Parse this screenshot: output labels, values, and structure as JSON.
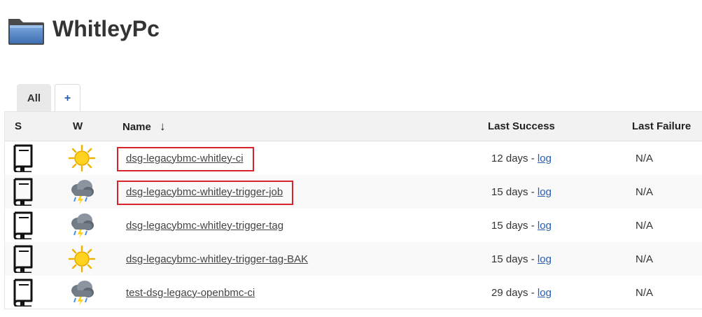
{
  "page": {
    "title": "WhitleyPc"
  },
  "tabs": [
    {
      "label": "All",
      "active": true
    },
    {
      "label": "+",
      "active": false
    }
  ],
  "table": {
    "headers": {
      "s": "S",
      "w": "W",
      "name": "Name",
      "sort_indicator": "↓",
      "last_success": "Last Success",
      "last_failure": "Last Failure"
    },
    "rows": [
      {
        "status_icon": "book-icon",
        "weather_icon": "sunny-icon",
        "name": "dsg-legacybmc-whitley-ci",
        "last_success_time": "12 days",
        "separator": " - ",
        "log_label": "log",
        "last_failure": "N/A",
        "highlighted": true
      },
      {
        "status_icon": "book-icon",
        "weather_icon": "storm-icon",
        "name": "dsg-legacybmc-whitley-trigger-job",
        "last_success_time": "15 days",
        "separator": " - ",
        "log_label": "log",
        "last_failure": "N/A",
        "highlighted": true
      },
      {
        "status_icon": "book-icon",
        "weather_icon": "storm-icon",
        "name": "dsg-legacybmc-whitley-trigger-tag",
        "last_success_time": "15 days",
        "separator": " - ",
        "log_label": "log",
        "last_failure": "N/A",
        "highlighted": false
      },
      {
        "status_icon": "book-icon",
        "weather_icon": "sunny-icon",
        "name": "dsg-legacybmc-whitley-trigger-tag-BAK",
        "last_success_time": "15 days",
        "separator": " - ",
        "log_label": "log",
        "last_failure": "N/A",
        "highlighted": false
      },
      {
        "status_icon": "book-icon",
        "weather_icon": "storm-icon",
        "name": "test-dsg-legacy-openbmc-ci",
        "last_success_time": "29 days",
        "separator": " - ",
        "log_label": "log",
        "last_failure": "N/A",
        "highlighted": false
      }
    ]
  },
  "colors": {
    "highlight": "#d9232d",
    "link": "#2a5db0",
    "header_bg": "#f2f2f2",
    "tab_active_bg": "#e9e9e9"
  }
}
